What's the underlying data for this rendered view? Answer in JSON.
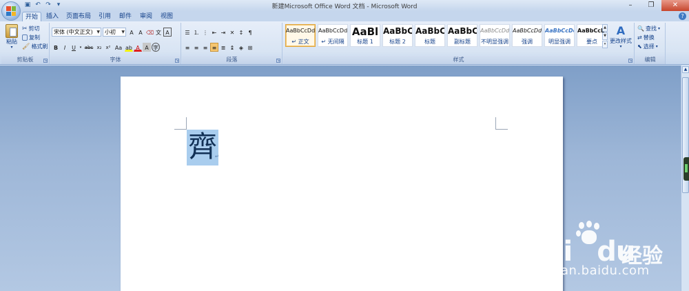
{
  "window": {
    "title": "新建Microsoft Office Word 文档 - Microsoft Word",
    "minimize_icon": "minimize-icon",
    "maximize_icon": "restore-icon",
    "close_icon": "close-icon"
  },
  "tabs": [
    {
      "label": "开始",
      "active": true
    },
    {
      "label": "插入"
    },
    {
      "label": "页面布局"
    },
    {
      "label": "引用"
    },
    {
      "label": "邮件"
    },
    {
      "label": "审阅"
    },
    {
      "label": "视图"
    }
  ],
  "clipboard": {
    "group_label": "剪贴板",
    "paste_label": "粘贴",
    "cut_label": "剪切",
    "copy_label": "复制",
    "format_painter_label": "格式刷"
  },
  "font": {
    "group_label": "字体",
    "font_name": "宋体 (中文正文)",
    "font_size": "小初",
    "bold": "B",
    "italic": "I",
    "underline": "U",
    "strikethrough": "abc",
    "subscript": "x₂",
    "superscript": "x²",
    "change_case": "Aa",
    "grow_font": "A",
    "shrink_font": "A",
    "clear_format": "A",
    "char_border": "A"
  },
  "paragraph": {
    "group_label": "段落",
    "active_button": "justify"
  },
  "styles": {
    "group_label": "样式",
    "items": [
      {
        "sample": "AaBbCcDd",
        "name": "↵ 正文",
        "selected": true
      },
      {
        "sample": "AaBbCcDd",
        "name": "↵ 无间隔"
      },
      {
        "sample": "AaBl",
        "name": "标题 1"
      },
      {
        "sample": "AaBbC",
        "name": "标题 2"
      },
      {
        "sample": "AaBbC",
        "name": "标题"
      },
      {
        "sample": "AaBbC",
        "name": "副标题"
      },
      {
        "sample": "AaBbCcDd",
        "name": "不明显强调"
      },
      {
        "sample": "AaBbCcDd",
        "name": "强调"
      },
      {
        "sample": "AaBbCcDc",
        "name": "明显强调"
      },
      {
        "sample": "AaBbCcDc",
        "name": "要点"
      }
    ],
    "change_styles_label": "更改样式"
  },
  "editing": {
    "group_label": "编辑",
    "find_label": "查找",
    "replace_label": "替换",
    "select_label": "选择"
  },
  "document": {
    "selected_text": "齊",
    "para_mark": "↵"
  },
  "watermark": {
    "brand": "Bai",
    "brand_suffix": "du",
    "cn": "经验",
    "url": "jingyan.baidu.com"
  }
}
